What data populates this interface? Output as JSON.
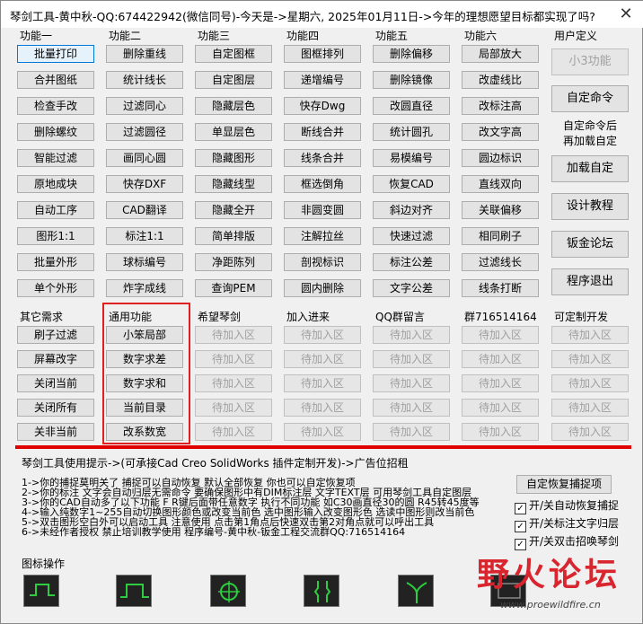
{
  "window": {
    "title": "琴剑工具-黄中秋-QQ:674422942(微信同号)-今天是->星期六, 2025年01月11日->今年的理想愿望目标都实现了吗?",
    "close_glyph": "✕"
  },
  "groups": {
    "g1": {
      "label": "功能一",
      "buttons": [
        "批量打印",
        "合并图纸",
        "检查手改",
        "删除螺纹",
        "智能过滤",
        "原地成块",
        "自动工序",
        "图形1:1",
        "批量外形",
        "单个外形"
      ]
    },
    "g2": {
      "label": "功能二",
      "buttons": [
        "删除重线",
        "统计线长",
        "过滤同心",
        "过滤圆径",
        "画同心圆",
        "快存DXF",
        "CAD翻译",
        "标注1:1",
        "球标编号",
        "炸字成线"
      ]
    },
    "g3": {
      "label": "功能三",
      "buttons": [
        "自定图框",
        "自定图层",
        "隐藏层色",
        "单显层色",
        "隐藏图形",
        "隐藏线型",
        "隐藏全开",
        "简单排版",
        "净距陈列",
        "查询PEM"
      ]
    },
    "g4": {
      "label": "功能四",
      "buttons": [
        "图框排列",
        "递增编号",
        "快存Dwg",
        "断线合并",
        "线条合并",
        "框选倒角",
        "非圆变圆",
        "注解拉丝",
        "剖视标识",
        "圆内删除"
      ]
    },
    "g5": {
      "label": "功能五",
      "buttons": [
        "删除偏移",
        "删除镜像",
        "改圆直径",
        "统计圆孔",
        "易模编号",
        "恢复CAD",
        "斜边对齐",
        "快速过滤",
        "标注公差",
        "文字公差"
      ]
    },
    "g6": {
      "label": "功能六",
      "buttons": [
        "局部放大",
        "改虚线比",
        "改标注高",
        "改文字高",
        "圆边标识",
        "直线双向",
        "关联偏移",
        "相同刷子",
        "过滤线长",
        "线条打断"
      ]
    },
    "user": {
      "label": "用户定义",
      "small3": "小3功能",
      "custom_cmd": "自定命令",
      "note_line1": "自定命令后",
      "note_line2": "再加载自定",
      "load": "加载自定",
      "tutorial": "设计教程",
      "forum": "钣金论坛",
      "exit": "程序退出"
    },
    "other": {
      "label": "其它需求",
      "buttons": [
        "刷子过滤",
        "屏幕改字",
        "关闭当前",
        "关闭所有",
        "关非当前"
      ]
    },
    "common": {
      "label": "通用功能",
      "buttons": [
        "小笨局部",
        "数字求差",
        "数字求和",
        "当前目录",
        "改系数宽"
      ]
    },
    "hope": {
      "label": "希望琴剑"
    },
    "join": {
      "label": "加入进来"
    },
    "qq": {
      "label": "QQ群留言"
    },
    "qun": {
      "label": "群716514164"
    },
    "custom_dev": {
      "label": "可定制开发"
    },
    "placeholder": "待加入区"
  },
  "tips": {
    "title": "琴剑工具使用提示->(可承接Cad Creo SolidWorks 插件定制开发)->广告位招租",
    "lines": [
      "1->你的捕捉莫明关了 捕捉可以自动恢复 默认全部恢复 你也可以自定恢复项",
      "2->你的标注 文字会自动归层无需命令 要确保图形中有DIM标注层 文字TEXT层 可用琴剑工具自定图层",
      "3->你的CAD自动多了以下功能 F R键后面带任意数字 执行不同功能 如C30画直径30的圆 R45转45度等",
      "4->输入纯数字1~255自动切换图形颜色或改变当前色 选中图形输入改变图形色 选读中图形则改当前色",
      "5->双击图形空白外可以启动工具 注意使用 点击第1角点后快速双击第2对角点就可以呼出工具",
      "6->未经作者授权 禁止培训教学使用 程序编号-黄中秋-钣金工程交流群QQ:716514164"
    ],
    "restore_button": "自定恢复捕捉项",
    "checks": [
      {
        "label": "开/关自动恢复捕捉",
        "checked": true
      },
      {
        "label": "开/关标注文字归层",
        "checked": true
      },
      {
        "label": "开/关双击招唤琴剑",
        "checked": true
      }
    ]
  },
  "icons": {
    "label": "图标操作",
    "items": [
      "notch-up-icon",
      "notch-wide-icon",
      "circle-center-icon",
      "bracket-pair-icon",
      "y-shape-icon",
      "screen-icon"
    ]
  },
  "watermark": {
    "text": "野火论坛",
    "url": "www.proewildfire.cn"
  },
  "colors": {
    "red_highlight": "#e02020",
    "icon_green": "#2ecc40",
    "window_bg": "#f0f0f0"
  }
}
